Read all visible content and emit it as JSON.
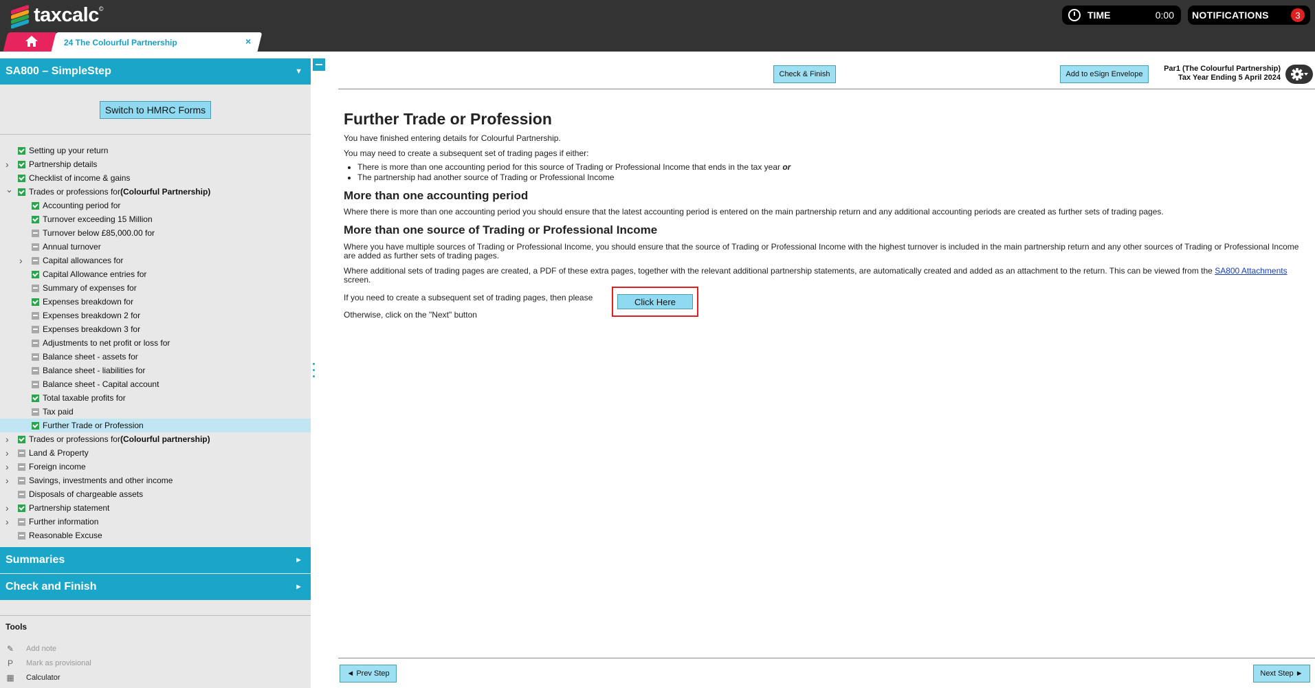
{
  "app": {
    "name": "taxcalc",
    "trademark": "©"
  },
  "topbar": {
    "time_label": "TIME",
    "time_value": "0:00",
    "notifications_label": "NOTIFICATIONS",
    "notifications_count": "3"
  },
  "tabs": {
    "document_tab": "24 The Colourful Partnership",
    "close_glyph": "×"
  },
  "sidebar": {
    "title": "SA800 – SimpleStep",
    "switch_button": "Switch to HMRC Forms",
    "items": [
      {
        "label": "Setting up your return",
        "status": "tick",
        "level": 0
      },
      {
        "label": "Partnership details",
        "status": "tick",
        "level": 0,
        "chev": "right"
      },
      {
        "label": "Checklist of income & gains",
        "status": "tick",
        "level": 0
      },
      {
        "label": "Trades or professions for ",
        "bold": "(Colourful Partnership)",
        "status": "tick",
        "level": 0,
        "chev": "down"
      },
      {
        "label": "Accounting period for",
        "status": "tick",
        "level": 1
      },
      {
        "label": "Turnover exceeding 15 Million",
        "status": "tick",
        "level": 1
      },
      {
        "label": "Turnover below £85,000.00 for",
        "status": "dash",
        "level": 1
      },
      {
        "label": "Annual turnover",
        "status": "dash",
        "level": 1
      },
      {
        "label": "Capital allowances for",
        "status": "dash",
        "level": 1,
        "chev": "right"
      },
      {
        "label": "Capital Allowance entries for",
        "status": "tick",
        "level": 1
      },
      {
        "label": "Summary of expenses for",
        "status": "dash",
        "level": 1
      },
      {
        "label": "Expenses breakdown for",
        "status": "tick",
        "level": 1
      },
      {
        "label": "Expenses breakdown 2 for",
        "status": "dash",
        "level": 1
      },
      {
        "label": "Expenses breakdown 3 for",
        "status": "dash",
        "level": 1
      },
      {
        "label": "Adjustments to net profit or loss for",
        "status": "dash",
        "level": 1
      },
      {
        "label": "Balance sheet - assets for",
        "status": "dash",
        "level": 1
      },
      {
        "label": "Balance sheet - liabilities for",
        "status": "dash",
        "level": 1
      },
      {
        "label": "Balance sheet - Capital account",
        "status": "dash",
        "level": 1
      },
      {
        "label": "Total taxable profits for",
        "status": "tick",
        "level": 1
      },
      {
        "label": "Tax paid",
        "status": "dash",
        "level": 1
      },
      {
        "label": "Further Trade or Profession",
        "status": "tick",
        "level": 1,
        "active": true
      },
      {
        "label": "Trades or professions for ",
        "bold": "(Colourful partnership)",
        "status": "tick",
        "level": 0,
        "chev": "right"
      },
      {
        "label": "Land & Property",
        "status": "dash",
        "level": 0,
        "chev": "right"
      },
      {
        "label": "Foreign income",
        "status": "dash",
        "level": 0,
        "chev": "right"
      },
      {
        "label": "Savings, investments and other income",
        "status": "dash",
        "level": 0,
        "chev": "right"
      },
      {
        "label": "Disposals of chargeable assets",
        "status": "dash",
        "level": 0
      },
      {
        "label": "Partnership statement",
        "status": "tick",
        "level": 0,
        "chev": "right"
      },
      {
        "label": "Further information",
        "status": "dash",
        "level": 0,
        "chev": "right"
      },
      {
        "label": "Reasonable Excuse",
        "status": "dash",
        "level": 0
      }
    ],
    "summaries": "Summaries",
    "check_finish": "Check and Finish",
    "tools_title": "Tools",
    "tools": [
      {
        "label": "Add note",
        "icon": "pencil-icon",
        "glyph": "✎",
        "disabled": true
      },
      {
        "label": "Mark as provisional",
        "icon": "provisional-icon",
        "glyph": "P",
        "disabled": true
      },
      {
        "label": "Calculator",
        "icon": "calculator-icon",
        "glyph": "▦",
        "disabled": false
      }
    ]
  },
  "toolbar": {
    "check_finish": "Check & Finish",
    "esign": "Add to eSign Envelope",
    "client_line1": "Par1 (The Colourful Partnership)",
    "client_line2": "Tax Year Ending 5 April 2024"
  },
  "content": {
    "title": "Further Trade or Profession",
    "p1": "You have finished entering details for Colourful Partnership.",
    "p2": "You may need to create a subsequent set of trading pages if either:",
    "bullet1": "There is more than one accounting period for this source of Trading or Professional Income that ends in the tax year ",
    "bullet1_em": "or",
    "bullet2": "The partnership had another source of Trading or Professional Income",
    "h2a": "More than one accounting period",
    "p3": "Where there is more than one accounting period you should ensure that the latest accounting period is entered on the main partnership return and any additional accounting periods are created as further sets of trading pages.",
    "h2b": "More than one source of Trading or Professional Income",
    "p4": "Where you have multiple sources of Trading or Professional Income, you should ensure that the source of Trading or Professional Income with the highest turnover is included in the main partnership return and any other sources of Trading or Professional Income are added as further sets of trading pages.",
    "p5": "Where additional sets of trading pages are created, a PDF of these extra pages, together with the relevant additional partnership statements, are automatically created and added as an attachment to the return. This can be viewed from the ",
    "p5_link": "SA800 Attachments",
    "p5_end": " screen.",
    "p6": "If you need to create a subsequent set of trading pages, then please",
    "click_here": "Click Here",
    "p7": "Otherwise, click on the \"Next\" button"
  },
  "footer": {
    "prev": "◄ Prev Step",
    "next": "Next Step ►"
  }
}
